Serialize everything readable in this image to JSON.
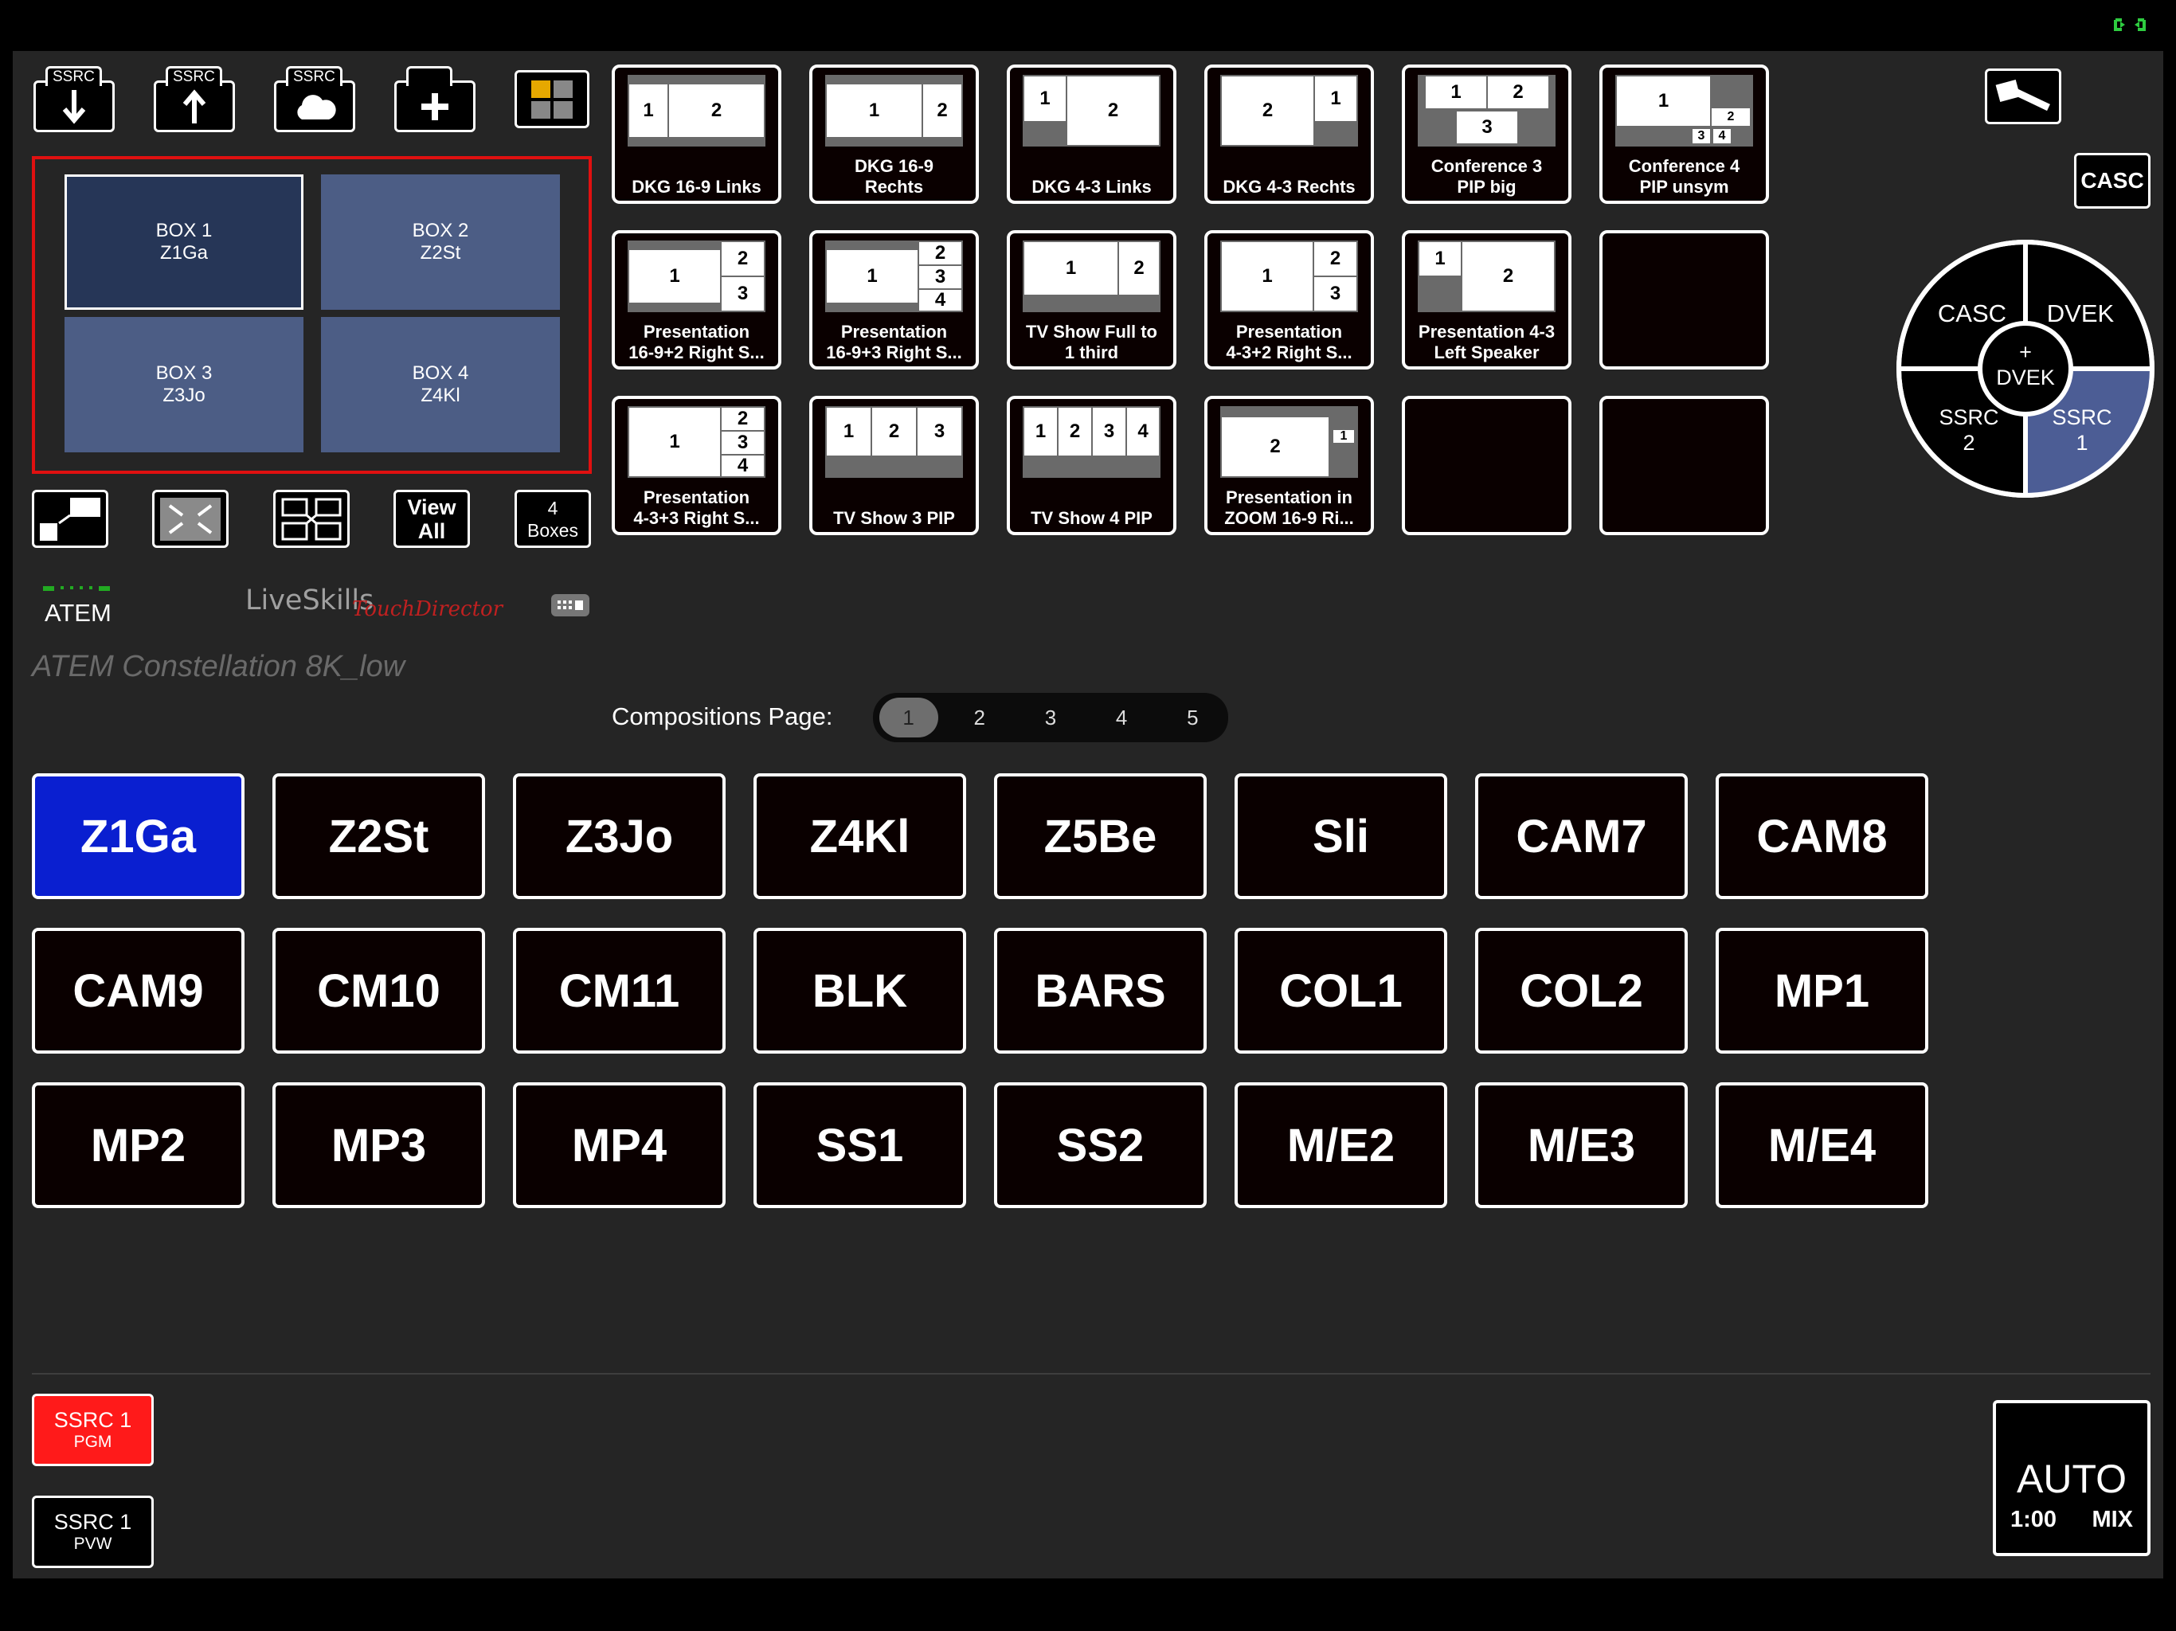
{
  "top_icons": {
    "ssrc_download_tab": "SSRC",
    "ssrc_upload_tab": "SSRC",
    "ssrc_cloud_tab": "SSRC"
  },
  "boxes": [
    {
      "name": "BOX 1",
      "source": "Z1Ga"
    },
    {
      "name": "BOX 2",
      "source": "Z2St"
    },
    {
      "name": "BOX 3",
      "source": "Z3Jo"
    },
    {
      "name": "BOX 4",
      "source": "Z4Kl"
    }
  ],
  "box_buttons": {
    "view_all_line1": "View",
    "view_all_line2": "All",
    "boxes_count": "4",
    "boxes_label": "Boxes"
  },
  "branding": {
    "atem": "ATEM",
    "liveskills": "LiveSkills",
    "touchdirector": "TouchDirector",
    "device_name": "ATEM Constellation 8K_low"
  },
  "compositions": [
    {
      "line1": "DKG 16-9 Links",
      "line2": ""
    },
    {
      "line1": "DKG 16-9",
      "line2": "Rechts"
    },
    {
      "line1": "DKG 4-3 Links",
      "line2": ""
    },
    {
      "line1": "DKG 4-3 Rechts",
      "line2": ""
    },
    {
      "line1": "Conference 3",
      "line2": "PIP big"
    },
    {
      "line1": "Conference 4",
      "line2": "PIP unsym"
    },
    {
      "line1": "Presentation",
      "line2": "16-9+2 Right S..."
    },
    {
      "line1": "Presentation",
      "line2": "16-9+3 Right S..."
    },
    {
      "line1": "TV Show Full to",
      "line2": "1 third"
    },
    {
      "line1": "Presentation",
      "line2": "4-3+2 Right S..."
    },
    {
      "line1": "Presentation 4-3",
      "line2": "Left Speaker"
    },
    {
      "line1": "",
      "line2": ""
    },
    {
      "line1": "Presentation",
      "line2": "4-3+3 Right S..."
    },
    {
      "line1": "TV Show 3 PIP",
      "line2": ""
    },
    {
      "line1": "TV Show 4 PIP",
      "line2": ""
    },
    {
      "line1": "Presentation in",
      "line2": "ZOOM 16-9 Ri..."
    },
    {
      "line1": "",
      "line2": ""
    },
    {
      "line1": "",
      "line2": ""
    }
  ],
  "thumb_numbers": [
    "1",
    "2",
    "3",
    "4"
  ],
  "right_panel": {
    "casc_button": "CASC",
    "wheel": {
      "casc": "CASC",
      "dvek": "DVEK",
      "center_plus": "+",
      "center_dvek": "DVEK",
      "ssrc2_line1": "SSRC",
      "ssrc2_line2": "2",
      "ssrc1_line1": "SSRC",
      "ssrc1_line2": "1"
    }
  },
  "pager": {
    "label": "Compositions Page:",
    "pages": [
      "1",
      "2",
      "3",
      "4",
      "5"
    ],
    "current": "1"
  },
  "sources": [
    "Z1Ga",
    "Z2St",
    "Z3Jo",
    "Z4Kl",
    "Z5Be",
    "Sli",
    "CAM7",
    "CAM8",
    "CAM9",
    "CM10",
    "CM11",
    "BLK",
    "BARS",
    "COL1",
    "COL2",
    "MP1",
    "MP2",
    "MP3",
    "MP4",
    "SS1",
    "SS2",
    "M/E2",
    "M/E3",
    "M/E4"
  ],
  "active_source": "Z1Ga",
  "bus": {
    "pgm_line1": "SSRC 1",
    "pgm_line2": "PGM",
    "pvw_line1": "SSRC 1",
    "pvw_line2": "PVW"
  },
  "transition": {
    "label": "AUTO",
    "rate": "1:00",
    "type": "MIX"
  },
  "colors": {
    "active_source": "#0a1fd0",
    "pgm": "#ff1a1a",
    "box_area_border": "#e01010",
    "wheel_selected": "#4c5d95",
    "atem_led": "#22aa22"
  }
}
